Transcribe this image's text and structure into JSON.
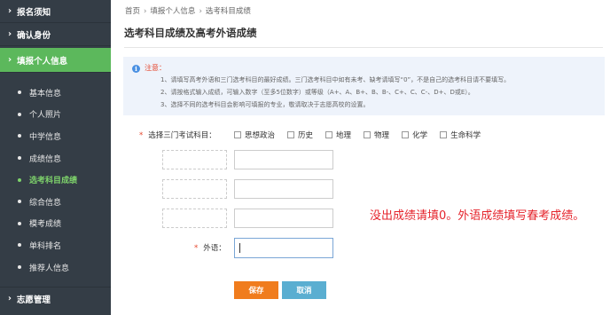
{
  "sidebar": {
    "top_items": [
      {
        "label": "报名须知"
      },
      {
        "label": "确认身份"
      },
      {
        "label": "填报个人信息"
      }
    ],
    "sub_items": [
      {
        "label": "基本信息"
      },
      {
        "label": "个人照片"
      },
      {
        "label": "中学信息"
      },
      {
        "label": "成绩信息"
      },
      {
        "label": "选考科目成绩"
      },
      {
        "label": "综合信息"
      },
      {
        "label": "模考成绩"
      },
      {
        "label": "单科排名"
      },
      {
        "label": "推荐人信息"
      }
    ],
    "bottom_item": {
      "label": "志愿管理"
    },
    "chevron": "›"
  },
  "breadcrumb": {
    "items": [
      "首页",
      "填报个人信息",
      "选考科目成绩"
    ],
    "separator": "›"
  },
  "page_title": "选考科目成绩及高考外语成绩",
  "notice": {
    "icon": "i",
    "title": "注意：",
    "lines": [
      "1、请填写高考外语和三门选考科目的最好成绩。三门选考科目中如有未考、缺考请填写“0”，不是自己的选考科目请不要填写。",
      "2、请按格式输入成绩，可输入数字（至多5位数字）或等级（A+、A、B+、B、B-、C+、C、C-、D+、D或E）。",
      "3、选择不同的选考科目会影响可填报的专业，敬请取决于志愿高校的设置。"
    ]
  },
  "form": {
    "required_mark": "*",
    "subjects_label": "选择三门考试科目：",
    "subjects": [
      "思想政治",
      "历史",
      "地理",
      "物理",
      "化学",
      "生命科学"
    ],
    "foreign_label": "外语："
  },
  "note": "没出成绩请填0。外语成绩填写春考成绩。",
  "buttons": {
    "save": "保存",
    "cancel": "取消"
  },
  "colors": {
    "sidebar_bg": "#343d46",
    "active_menu": "#5cb85c",
    "current_sub": "#7ed36b",
    "save_button": "#f07c1d",
    "cancel_button": "#5aaed1",
    "note_text": "#e5242c"
  }
}
